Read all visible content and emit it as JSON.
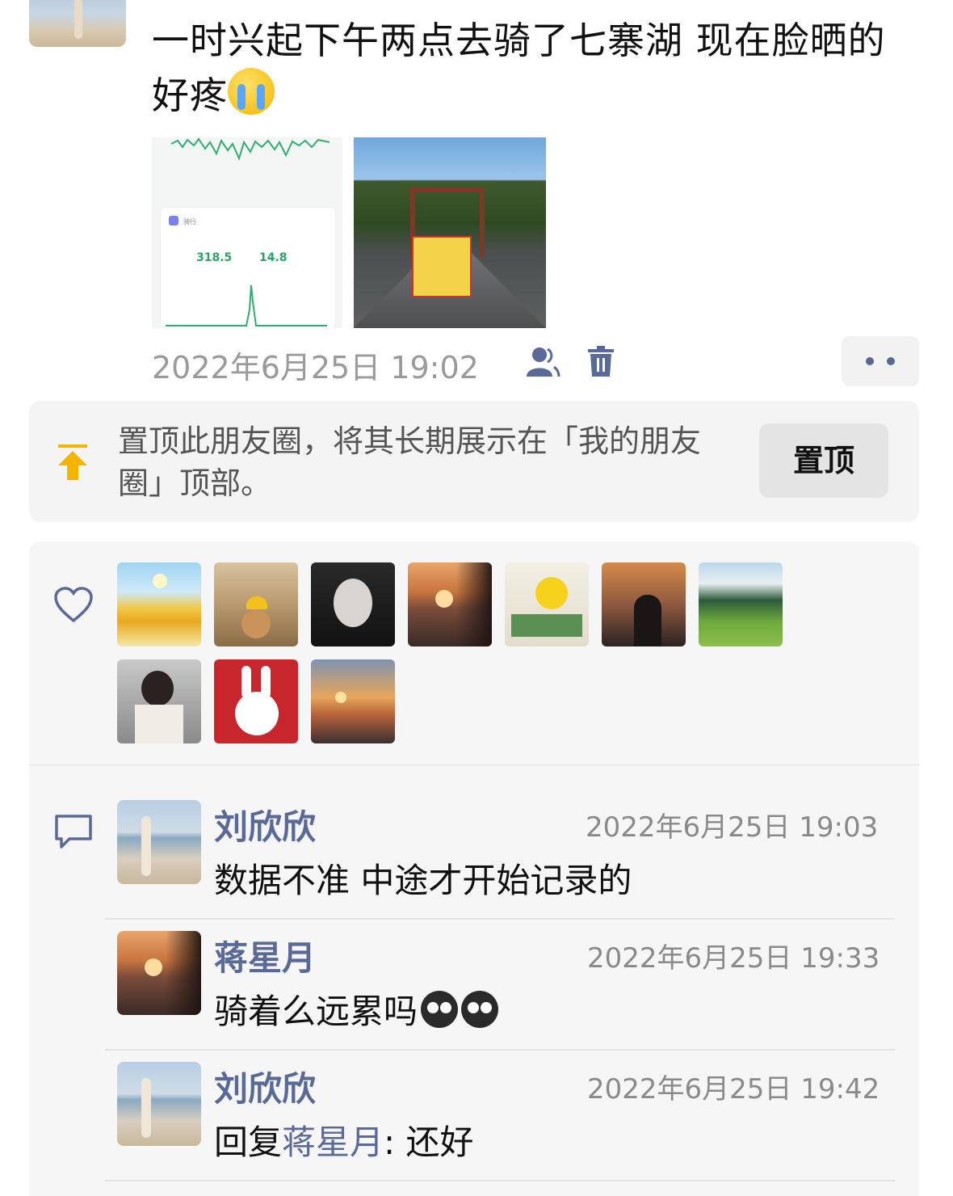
{
  "post": {
    "text": "一时兴起下午两点去骑了七寨湖 现在脸晒的好疼",
    "emoji": "loudly-crying-face",
    "time": "2022年6月25日 19:02",
    "images": [
      {
        "kind": "cycling-stats-screenshot",
        "stat1": "318.5",
        "stat2": "14.8",
        "card_title": "骑行"
      },
      {
        "kind": "road-photo"
      }
    ]
  },
  "pin": {
    "description": "置顶此朋友圈，将其长期展示在「我的朋友圈」顶部。",
    "button": "置顶"
  },
  "likes": {
    "icon": "heart-icon",
    "avatars": [
      "avatar-like-1",
      "avatar-like-2",
      "avatar-like-3",
      "avatar-like-4",
      "avatar-like-5",
      "avatar-like-6",
      "avatar-like-7",
      "avatar-like-8",
      "avatar-like-9",
      "avatar-like-10"
    ]
  },
  "comments": [
    {
      "name": "刘欣欣",
      "time": "2022年6月25日 19:03",
      "text": "数据不准 中途才开始记录的"
    },
    {
      "name": "蒋星月",
      "time": "2022年6月25日 19:33",
      "text": "骑着么远累吗",
      "emoji": "sad-face-emoji"
    },
    {
      "name": "刘欣欣",
      "time": "2022年6月25日 19:42",
      "reply_prefix": "回复",
      "reply_to": "蒋星月",
      "reply_sep": ":",
      "text": " 还好"
    }
  ],
  "colors": {
    "link": "#5a6a98",
    "muted": "#9a9a9a",
    "panel": "#f6f6f6",
    "pin_accent": "#f5b400"
  }
}
